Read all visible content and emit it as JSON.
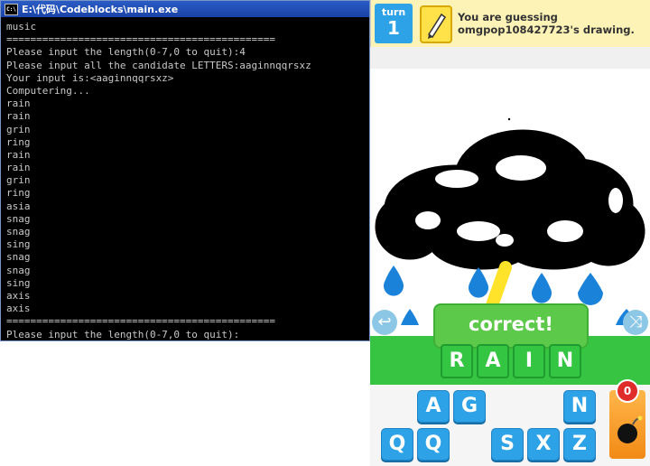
{
  "console": {
    "title": "E:\\代码\\Codeblocks\\main.exe",
    "icon": "cmd-icon",
    "lines": [
      "music",
      "=============================================",
      "Please input the length(0-7,0 to quit):4",
      "Please input all the candidate LETTERS:aaginnqqrsxz",
      "Your input is:<aaginnqqrsxz>",
      "Computering...",
      "rain",
      "rain",
      "grin",
      "ring",
      "rain",
      "rain",
      "grin",
      "ring",
      "asia",
      "snag",
      "snag",
      "sing",
      "snag",
      "snag",
      "sing",
      "axis",
      "axis",
      "=============================================",
      "Please input the length(0-7,0 to quit):"
    ]
  },
  "game": {
    "turn_label": "turn",
    "turn_number": "1",
    "header_text": "You are guessing omgpop108427723's drawing.",
    "correct_text": "correct!",
    "answer_letters": [
      "R",
      "A",
      "I",
      "N"
    ],
    "keyboard_row1": [
      "A",
      "G",
      "N"
    ],
    "keyboard_row2": [
      "Q",
      "Q",
      "S",
      "X",
      "Z"
    ],
    "bomb_count": "0",
    "colors": {
      "turn_blue": "#2ea2e6",
      "correct_green": "#36c442",
      "drawing_black": "#000000",
      "drop_blue": "#1a82d8",
      "lightning_yellow": "#ffe22a"
    }
  }
}
